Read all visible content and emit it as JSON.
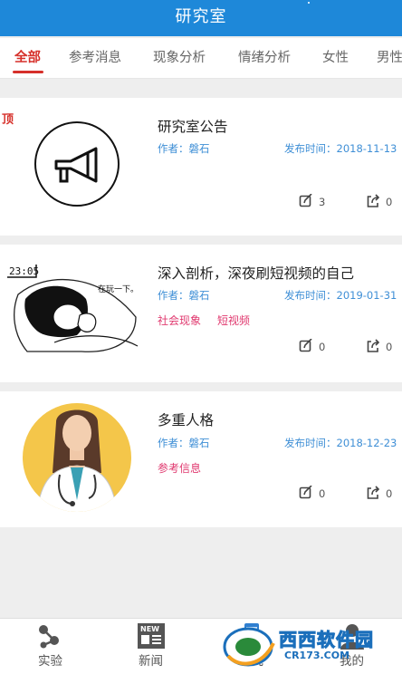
{
  "header": {
    "title": "研究室"
  },
  "tabs": [
    {
      "label": "全部",
      "active": true
    },
    {
      "label": "参考消息"
    },
    {
      "label": "现象分析"
    },
    {
      "label": "情绪分析"
    },
    {
      "label": "女性"
    },
    {
      "label": "男性"
    }
  ],
  "pinned_label": "顶",
  "articles": [
    {
      "title": "研究室公告",
      "author": "作者：磐石",
      "published": "发布时间：2018-11-13",
      "tags": [],
      "comments": "3",
      "shares": "0",
      "thumb_icon": "megaphone-icon"
    },
    {
      "title": "深入剖析，深夜刷短视频的自己",
      "author": "作者：磐石",
      "published": "发布时间：2019-01-31",
      "tags": [
        "社会现象",
        "短视频"
      ],
      "comments": "0",
      "shares": "0",
      "thumb_time": "23:05",
      "thumb_caption": "在玩一下。"
    },
    {
      "title": "多重人格",
      "author": "作者：磐石",
      "published": "发布时间：2018-12-23",
      "tags": [
        "参考信息"
      ],
      "comments": "0",
      "shares": "0",
      "thumb_icon": "doctor-illustration"
    }
  ],
  "bottom_nav": [
    {
      "label": "实验",
      "icon": "molecule-icon"
    },
    {
      "label": "新闻",
      "icon": "newspaper-icon"
    },
    {
      "label": "研究",
      "icon": "phone-icon",
      "active": true
    },
    {
      "label": "我的",
      "icon": "user-icon"
    }
  ],
  "nav_icon_badge": "NEW",
  "watermark": {
    "brand": "西西软件园",
    "url": "CR173.COM"
  },
  "colors": {
    "primary": "#1e88d9",
    "accent": "#d6302a",
    "tag": "#e0396f",
    "meta": "#3f8fd6"
  }
}
